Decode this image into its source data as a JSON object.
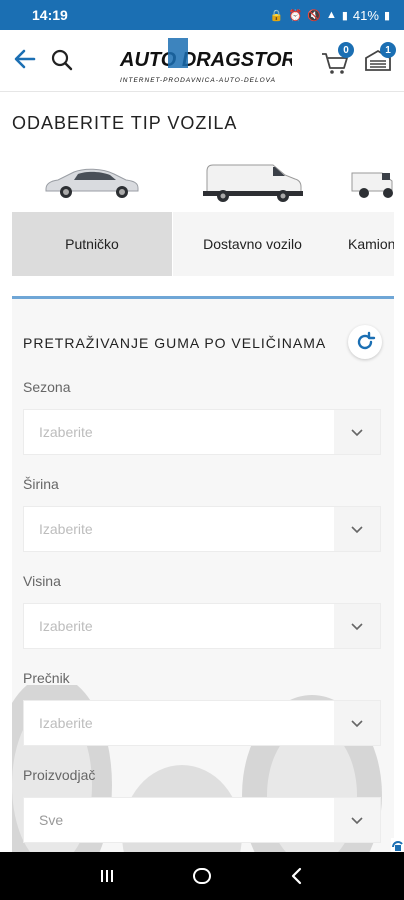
{
  "status_bar": {
    "time": "14:19",
    "battery": "41%"
  },
  "header": {
    "logo": "AUTO DRAGSTOR",
    "logo_tagline": "INTERNET-PRODAVNICA-AUTO-DELOVA",
    "cart_count": "0",
    "garage_count": "1"
  },
  "vehicle_section": {
    "title": "ODABERITE TIP VOZILA",
    "types": [
      {
        "label": "Putničko",
        "icon": "sedan-car-image",
        "selected": true
      },
      {
        "label": "Dostavno vozilo",
        "icon": "delivery-van-image",
        "selected": false
      },
      {
        "label": "Kamion",
        "icon": "truck-image",
        "selected": false
      }
    ]
  },
  "search_panel": {
    "title": "PRETRAŽIVANJE GUMA PO VELIČINAMA",
    "accent": "#1b6fb3",
    "fields": [
      {
        "label": "Sezona",
        "value": "Izaberite"
      },
      {
        "label": "Širina",
        "value": "Izaberite"
      },
      {
        "label": "Visina",
        "value": "Izaberite"
      },
      {
        "label": "Prečnik",
        "value": "Izaberite"
      },
      {
        "label": "Proizvodjač",
        "value": "Sve"
      }
    ]
  }
}
